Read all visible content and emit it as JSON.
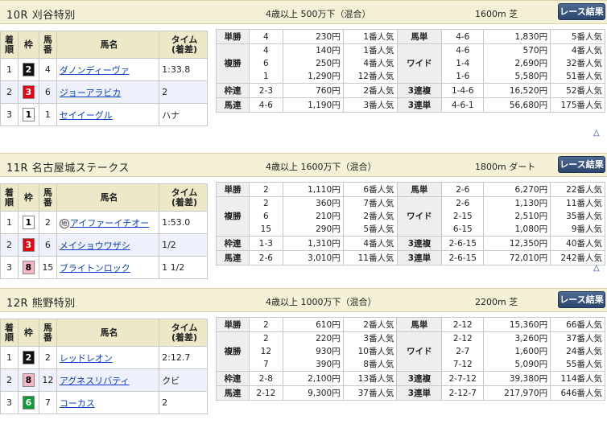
{
  "button_label": "レース結果",
  "top_icon": "△",
  "headers": {
    "rank": "着\n順",
    "waku": "枠",
    "num": "馬\n番",
    "name": "馬名",
    "time": "タイム\n(着差)"
  },
  "bet_labels": {
    "win": "単勝",
    "place": "複勝",
    "bracket": "枠連",
    "quinella": "馬連",
    "exacta": "馬単",
    "wide": "ワイド",
    "trio": "3連複",
    "trifecta": "3連単"
  },
  "races": [
    {
      "title": "10R 刈谷特別",
      "conditions": "4歳以上 500万下（混合）",
      "distance": "1600m 芝",
      "results": [
        {
          "rank": "1",
          "waku": "2",
          "num": "4",
          "name": "ダノンディーヴァ",
          "time": "1:33.8",
          "mark": ""
        },
        {
          "rank": "2",
          "waku": "3",
          "num": "6",
          "name": "ジョーアラビカ",
          "time": "2",
          "mark": ""
        },
        {
          "rank": "3",
          "waku": "1",
          "num": "1",
          "name": "セイイーグル",
          "time": "ハナ",
          "mark": ""
        }
      ],
      "payouts": {
        "win": {
          "combo": "4",
          "yen": "230円",
          "pop": "1番人気"
        },
        "place": {
          "combo": "4\n6\n1",
          "yen": "140円\n250円\n1,290円",
          "pop": "1番人気\n4番人気\n12番人気"
        },
        "bracket": {
          "combo": "2-3",
          "yen": "760円",
          "pop": "2番人気"
        },
        "quinella": {
          "combo": "4-6",
          "yen": "1,190円",
          "pop": "3番人気"
        },
        "exacta": {
          "combo": "4-6",
          "yen": "1,830円",
          "pop": "5番人気"
        },
        "wide": {
          "combo": "4-6\n1-4\n1-6",
          "yen": "570円\n2,690円\n5,580円",
          "pop": "4番人気\n32番人気\n51番人気"
        },
        "trio": {
          "combo": "1-4-6",
          "yen": "16,520円",
          "pop": "52番人気"
        },
        "trifecta": {
          "combo": "4-6-1",
          "yen": "56,680円",
          "pop": "175番人気"
        }
      }
    },
    {
      "title": "11R 名古屋城ステークス",
      "conditions": "4歳以上 1600万下（混合）",
      "distance": "1800m ダート",
      "results": [
        {
          "rank": "1",
          "waku": "1",
          "num": "2",
          "name": "アイファーイチオー",
          "time": "1:53.0",
          "mark": "地"
        },
        {
          "rank": "2",
          "waku": "3",
          "num": "6",
          "name": "メイショウワザシ",
          "time": "1/2",
          "mark": ""
        },
        {
          "rank": "3",
          "waku": "8",
          "num": "15",
          "name": "ブライトンロック",
          "time": "1 1/2",
          "mark": ""
        }
      ],
      "payouts": {
        "win": {
          "combo": "2",
          "yen": "1,110円",
          "pop": "6番人気"
        },
        "place": {
          "combo": "2\n6\n15",
          "yen": "360円\n210円\n290円",
          "pop": "7番人気\n2番人気\n5番人気"
        },
        "bracket": {
          "combo": "1-3",
          "yen": "1,310円",
          "pop": "4番人気"
        },
        "quinella": {
          "combo": "2-6",
          "yen": "3,010円",
          "pop": "11番人気"
        },
        "exacta": {
          "combo": "2-6",
          "yen": "6,270円",
          "pop": "22番人気"
        },
        "wide": {
          "combo": "2-6\n2-15\n6-15",
          "yen": "1,130円\n2,510円\n1,080円",
          "pop": "11番人気\n35番人気\n9番人気"
        },
        "trio": {
          "combo": "2-6-15",
          "yen": "12,350円",
          "pop": "40番人気"
        },
        "trifecta": {
          "combo": "2-6-15",
          "yen": "72,010円",
          "pop": "242番人気"
        }
      }
    },
    {
      "title": "12R 熊野特別",
      "conditions": "4歳以上 1000万下（混合）",
      "distance": "2200m 芝",
      "results": [
        {
          "rank": "1",
          "waku": "2",
          "num": "2",
          "name": "レッドレオン",
          "time": "2:12.7",
          "mark": ""
        },
        {
          "rank": "2",
          "waku": "8",
          "num": "12",
          "name": "アグネスリバティ",
          "time": "クビ",
          "mark": ""
        },
        {
          "rank": "3",
          "waku": "6",
          "num": "7",
          "name": "コーカス",
          "time": "2",
          "mark": ""
        }
      ],
      "payouts": {
        "win": {
          "combo": "2",
          "yen": "610円",
          "pop": "2番人気"
        },
        "place": {
          "combo": "2\n12\n7",
          "yen": "220円\n930円\n390円",
          "pop": "3番人気\n10番人気\n8番人気"
        },
        "bracket": {
          "combo": "2-8",
          "yen": "2,100円",
          "pop": "13番人気"
        },
        "quinella": {
          "combo": "2-12",
          "yen": "9,300円",
          "pop": "37番人気"
        },
        "exacta": {
          "combo": "2-12",
          "yen": "15,360円",
          "pop": "66番人気"
        },
        "wide": {
          "combo": "2-12\n2-7\n7-12",
          "yen": "3,260円\n1,600円\n5,090円",
          "pop": "37番人気\n24番人気\n55番人気"
        },
        "trio": {
          "combo": "2-7-12",
          "yen": "39,380円",
          "pop": "114番人気"
        },
        "trifecta": {
          "combo": "2-12-7",
          "yen": "217,970円",
          "pop": "646番人気"
        }
      }
    }
  ],
  "waku_colors": {
    "1": {
      "bg": "#ffffff",
      "fg": "#000000"
    },
    "2": {
      "bg": "#111111",
      "fg": "#ffffff"
    },
    "3": {
      "bg": "#e60012",
      "fg": "#ffffff"
    },
    "6": {
      "bg": "#109a3a",
      "fg": "#ffffff"
    },
    "8": {
      "bg": "#f7b6c4",
      "fg": "#000000"
    }
  }
}
